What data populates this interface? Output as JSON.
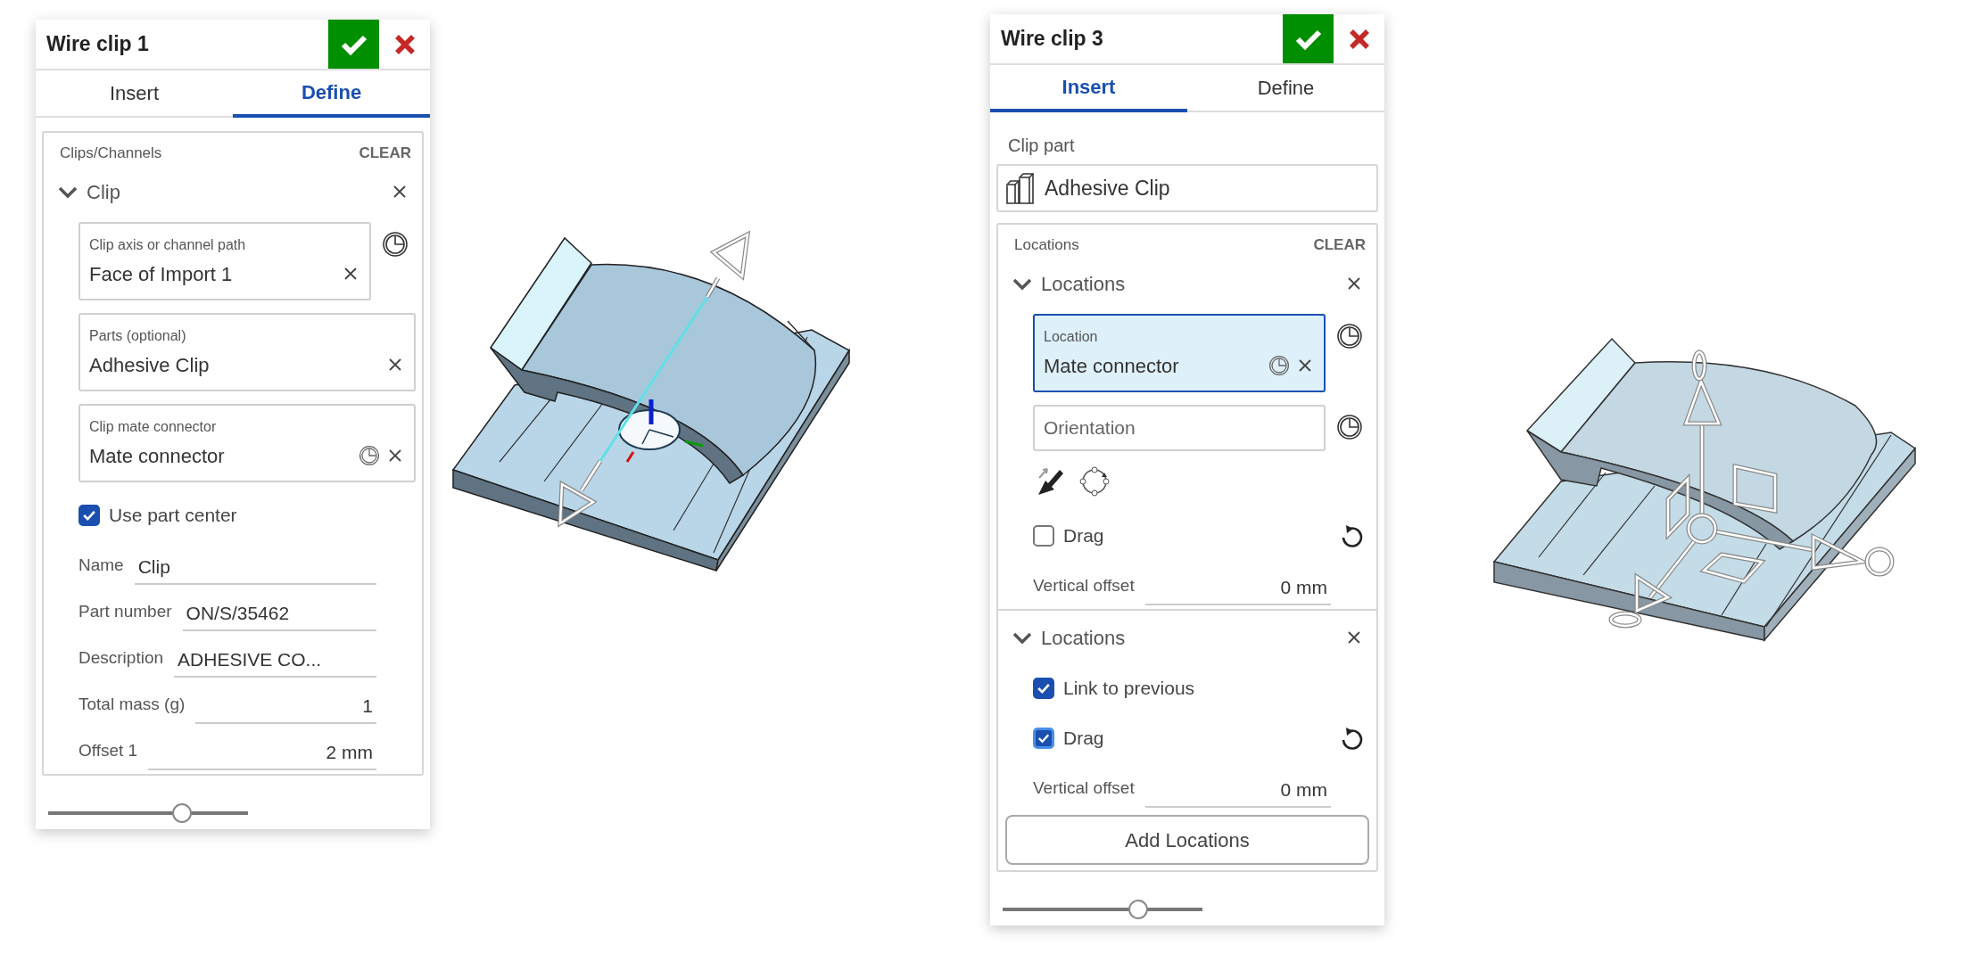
{
  "panels": [
    {
      "title": "Wire clip 1",
      "tabs": [
        {
          "label": "Insert",
          "selected": false
        },
        {
          "label": "Define",
          "selected": true
        }
      ],
      "body": [
        {
          "kind": "group",
          "label": "Clips/Channels",
          "action": "CLEAR",
          "items": [
            {
              "kind": "subgroup",
              "label": "Clip",
              "expanded": true,
              "items": [
                {
                  "kind": "field",
                  "label": "Clip axis or channel path",
                  "value": "Face of Import 1",
                  "inner_picker": false,
                  "outer_picker": true,
                  "focused": false
                },
                {
                  "kind": "field",
                  "label": "Parts (optional)",
                  "value": "Adhesive Clip",
                  "inner_picker": false,
                  "outer_picker": false,
                  "focused": false
                },
                {
                  "kind": "field",
                  "label": "Clip mate connector",
                  "value": "Mate connector",
                  "inner_picker": true,
                  "outer_picker": false,
                  "focused": false
                },
                {
                  "kind": "checkbox",
                  "label": "Use part center",
                  "checked": true,
                  "focused": false,
                  "reset": false
                },
                {
                  "kind": "property",
                  "label": "Name",
                  "value": "Clip",
                  "numeric": false
                },
                {
                  "kind": "property",
                  "label": "Part number",
                  "value": "ON/S/35462",
                  "numeric": false
                },
                {
                  "kind": "property",
                  "label": "Description",
                  "value": "ADHESIVE CO...",
                  "numeric": false
                },
                {
                  "kind": "property",
                  "label": "Total mass (g)",
                  "value": "1",
                  "numeric": true
                },
                {
                  "kind": "property",
                  "label": "Offset 1",
                  "value": "2 mm",
                  "numeric": true
                }
              ]
            }
          ]
        }
      ],
      "slider": {
        "level": 0.69
      }
    },
    {
      "title": "Wire clip 3",
      "tabs": [
        {
          "label": "Insert",
          "selected": true
        },
        {
          "label": "Define",
          "selected": false
        }
      ],
      "body": [
        {
          "kind": "heading",
          "label": "Clip part"
        },
        {
          "kind": "part",
          "value": "Adhesive Clip"
        },
        {
          "kind": "group",
          "label": "Locations",
          "action": "CLEAR",
          "items": [
            {
              "kind": "subgroup",
              "label": "Locations",
              "expanded": true,
              "items": [
                {
                  "kind": "field",
                  "label": "Location",
                  "value": "Mate connector",
                  "inner_picker": true,
                  "outer_picker": true,
                  "focused": true
                },
                {
                  "kind": "field",
                  "placeholder": "Orientation",
                  "inner_picker": false,
                  "outer_picker": true,
                  "focused": false
                },
                {
                  "kind": "tool_icons"
                },
                {
                  "kind": "checkbox",
                  "label": "Drag",
                  "checked": false,
                  "focused": false,
                  "reset": true
                },
                {
                  "kind": "property",
                  "label": "Vertical offset",
                  "value": "0 mm",
                  "numeric": true
                }
              ]
            },
            {
              "kind": "subgroup",
              "label": "Locations",
              "expanded": true,
              "items": [
                {
                  "kind": "checkbox",
                  "label": "Link to previous",
                  "checked": true,
                  "focused": false,
                  "reset": false
                },
                {
                  "kind": "checkbox",
                  "label": "Drag",
                  "checked": true,
                  "focused": true,
                  "reset": true
                },
                {
                  "kind": "property",
                  "label": "Vertical offset",
                  "value": "0 mm",
                  "numeric": true
                }
              ]
            },
            {
              "kind": "button",
              "label": "Add Locations"
            }
          ]
        }
      ],
      "slider": {
        "level": 0.7
      }
    }
  ]
}
